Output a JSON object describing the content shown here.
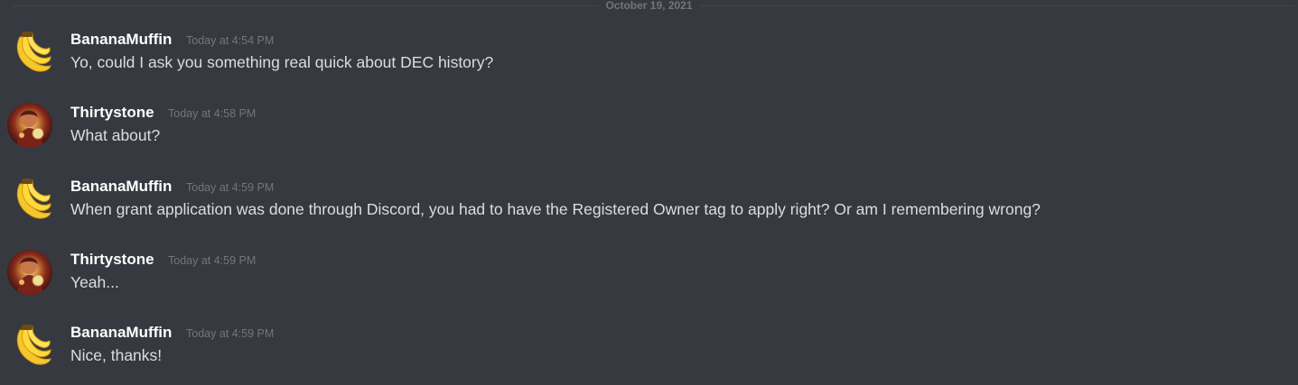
{
  "divider": {
    "date": "October 19, 2021"
  },
  "messages": [
    {
      "author": "BananaMuffin",
      "timestamp": "Today at 4:54 PM",
      "avatar": "banana-emoji-avatar",
      "text": "Yo, could I ask you something real quick about DEC history?"
    },
    {
      "author": "Thirtystone",
      "timestamp": "Today at 4:58 PM",
      "avatar": "character-portrait-avatar",
      "text": "What about?"
    },
    {
      "author": "BananaMuffin",
      "timestamp": "Today at 4:59 PM",
      "avatar": "banana-emoji-avatar",
      "text": "When grant application was done through Discord, you had to have the Registered Owner tag to apply right? Or am I remembering wrong?"
    },
    {
      "author": "Thirtystone",
      "timestamp": "Today at 4:59 PM",
      "avatar": "character-portrait-avatar",
      "text": "Yeah..."
    },
    {
      "author": "BananaMuffin",
      "timestamp": "Today at 4:59 PM",
      "avatar": "banana-emoji-avatar",
      "text": "Nice, thanks!"
    }
  ],
  "colors": {
    "background": "#36393f",
    "username": "#ffffff",
    "message_text": "#dcddde",
    "timestamp": "#72767d"
  }
}
